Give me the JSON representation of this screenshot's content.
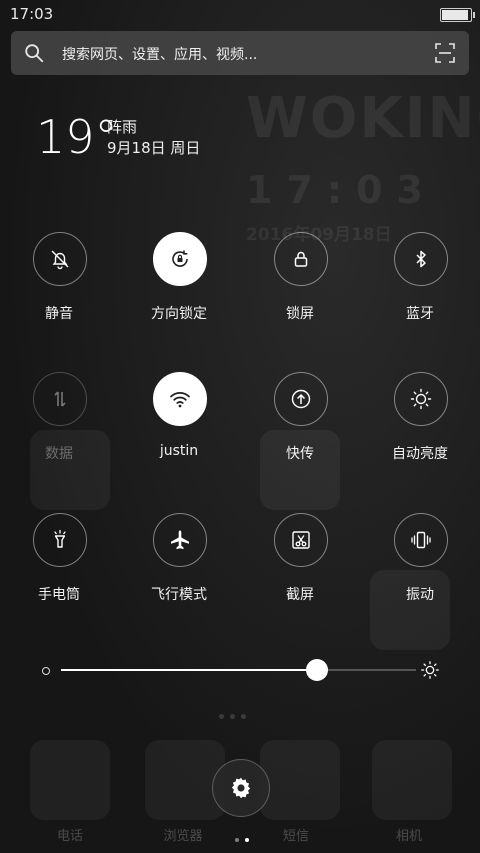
{
  "status_bar": {
    "time": "17:03",
    "battery_level": 1.0
  },
  "search": {
    "placeholder": "搜索网页、设置、应用、视频..."
  },
  "weather": {
    "temperature": "19°",
    "condition": "阵雨",
    "date": "9月18日 周日"
  },
  "wallpaper": {
    "logo": "WOKING",
    "clock": "17:03",
    "date": "2016年09月18日"
  },
  "toggles": [
    {
      "label": "静音",
      "icon": "bell-off-icon",
      "active": false,
      "dimmed": false
    },
    {
      "label": "方向锁定",
      "icon": "rotation-lock-icon",
      "active": true,
      "dimmed": false
    },
    {
      "label": "锁屏",
      "icon": "lock-icon",
      "active": false,
      "dimmed": false
    },
    {
      "label": "蓝牙",
      "icon": "bluetooth-icon",
      "active": false,
      "dimmed": false
    },
    {
      "label": "数据",
      "icon": "data-arrows-icon",
      "active": false,
      "dimmed": true
    },
    {
      "label": "justin",
      "icon": "wifi-icon",
      "active": true,
      "dimmed": false
    },
    {
      "label": "快传",
      "icon": "transfer-icon",
      "active": false,
      "dimmed": false
    },
    {
      "label": "自动亮度",
      "icon": "sun-icon",
      "active": false,
      "dimmed": false
    },
    {
      "label": "手电筒",
      "icon": "flashlight-icon",
      "active": false,
      "dimmed": false
    },
    {
      "label": "飞行模式",
      "icon": "airplane-icon",
      "active": false,
      "dimmed": false
    },
    {
      "label": "截屏",
      "icon": "screenshot-icon",
      "active": false,
      "dimmed": false
    },
    {
      "label": "振动",
      "icon": "vibrate-icon",
      "active": false,
      "dimmed": false
    }
  ],
  "brightness": {
    "level": 0.72
  },
  "dock": {
    "labels": [
      "电话",
      "浏览器",
      "短信",
      "相机"
    ]
  },
  "colors": {
    "accent": "#ffffff",
    "background": "#1c1c1c",
    "dim_text": "#6c6c6c"
  }
}
